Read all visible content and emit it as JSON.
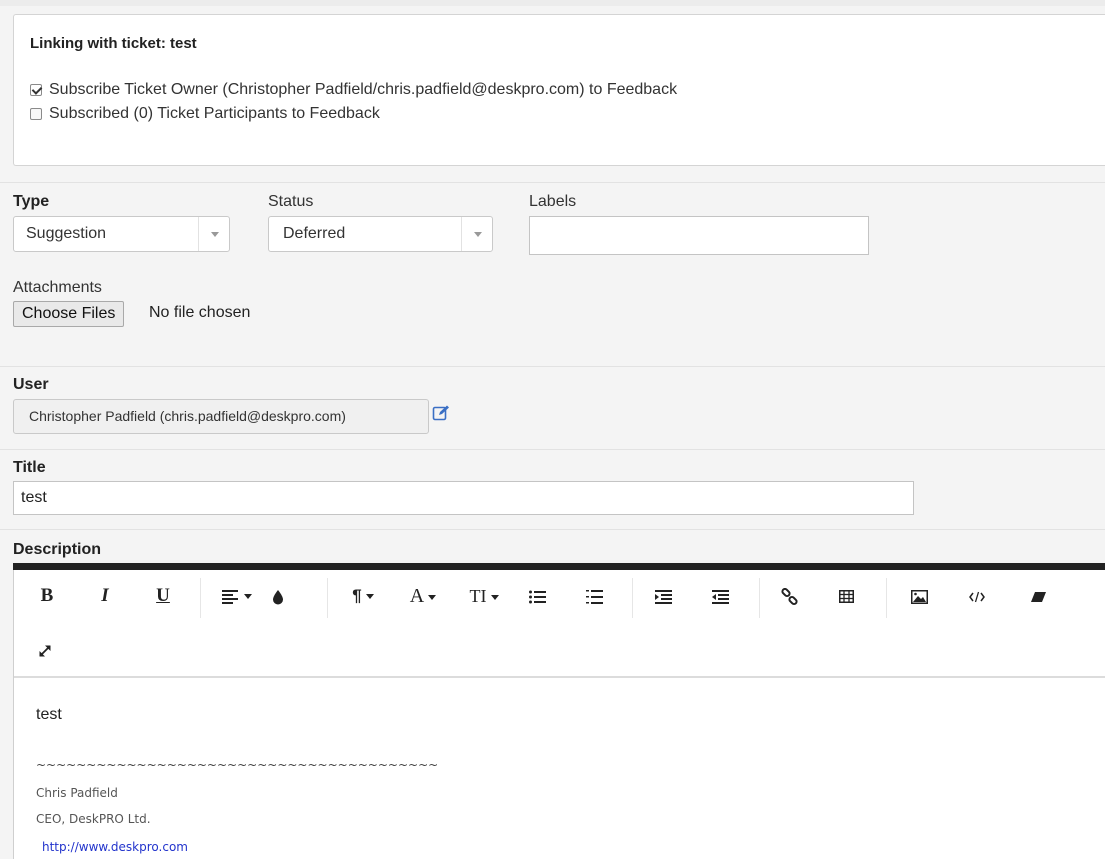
{
  "linking": {
    "title": "Linking with ticket: test",
    "subscribe_owner": {
      "label": "Subscribe Ticket Owner (Christopher Padfield/chris.padfield@deskpro.com) to Feedback",
      "checked": true
    },
    "subscribe_participants": {
      "label": "Subscribed (0) Ticket Participants to Feedback",
      "checked": false
    }
  },
  "fields": {
    "type": {
      "label": "Type",
      "value": "Suggestion"
    },
    "status": {
      "label": "Status",
      "value": "Deferred"
    },
    "labels": {
      "label": "Labels",
      "value": ""
    },
    "attachments": {
      "label": "Attachments",
      "button": "Choose Files",
      "status": "No file chosen"
    },
    "user": {
      "label": "User",
      "value": "Christopher Padfield (chris.padfield@deskpro.com)"
    },
    "title": {
      "label": "Title",
      "value": "test"
    },
    "description": {
      "label": "Description"
    }
  },
  "editor": {
    "toolbar": {
      "bold": "B",
      "italic": "I",
      "underline": "U",
      "paragraph": "¶",
      "font": "A",
      "text_size": "TI"
    },
    "content": {
      "text": "test",
      "separator": "~~~~~~~~~~~~~~~~~~~~~~~~~~~~~~~~~~~~~~~~",
      "sig_name": "Chris Padfield",
      "sig_title": "CEO, DeskPRO Ltd.",
      "sig_link": "http://www.deskpro.com"
    }
  },
  "colors": {
    "link": "#2233cc",
    "edit_icon": "#3a6fc4",
    "toolbar_bar": "#222222"
  }
}
